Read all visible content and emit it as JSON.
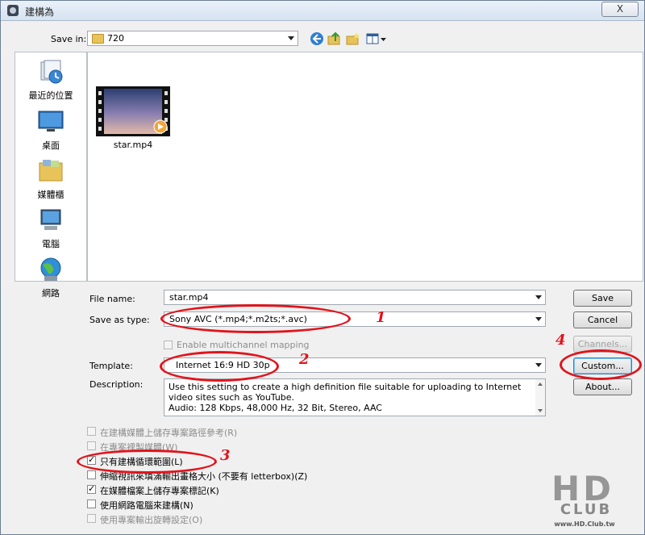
{
  "window": {
    "title": "建構為",
    "close_label": "X"
  },
  "toolbar": {
    "save_in_label": "Save in:",
    "folder": "720",
    "icons": [
      "back-icon",
      "up-folder-icon",
      "new-folder-icon",
      "views-menu-icon"
    ]
  },
  "places": [
    {
      "label": "最近的位置",
      "icon": "recent-places-icon"
    },
    {
      "label": "桌面",
      "icon": "desktop-icon"
    },
    {
      "label": "媒體櫃",
      "icon": "libraries-icon"
    },
    {
      "label": "電腦",
      "icon": "computer-icon"
    },
    {
      "label": "網路",
      "icon": "network-icon"
    }
  ],
  "files": [
    {
      "name": "star.mp4",
      "icon": "video-thumbnail"
    }
  ],
  "form": {
    "file_name_label": "File name:",
    "file_name_value": "star.mp4",
    "save_type_label": "Save as type:",
    "save_type_value": "Sony AVC (*.mp4;*.m2ts;*.avc)",
    "multichannel_label": "Enable multichannel mapping",
    "template_label": "Template:",
    "template_value": "Internet 16:9 HD 30p",
    "description_label": "Description:",
    "description_text": "Use this setting to create a high definition file suitable for uploading to Internet video sites such as YouTube.",
    "description_audio": "Audio: 128 Kbps, 48,000 Hz, 32 Bit, Stereo, AAC"
  },
  "buttons": {
    "save": "Save",
    "cancel": "Cancel",
    "channels": "Channels...",
    "custom": "Custom...",
    "about": "About..."
  },
  "options": [
    {
      "label": "在建構媒體上儲存專案路徑參考(R)",
      "checked": false,
      "enabled": false
    },
    {
      "label": "在專案裡製媒體(W)",
      "checked": false,
      "enabled": false
    },
    {
      "label": "只有建構循環範圍(L)",
      "checked": true,
      "enabled": true
    },
    {
      "label": "伸縮視訊來填滿輸出畫格大小 (不要有 letterbox)(Z)",
      "checked": false,
      "enabled": true
    },
    {
      "label": "在媒體檔案上儲存專案標記(K)",
      "checked": true,
      "enabled": true
    },
    {
      "label": "使用網路電腦來建構(N)",
      "checked": false,
      "enabled": true
    },
    {
      "label": "使用專案輸出旋轉設定(O)",
      "checked": false,
      "enabled": false
    }
  ],
  "annotations": {
    "n1": "1",
    "n2": "2",
    "n3": "3",
    "n4": "4",
    "color": "#e1141c"
  },
  "watermark": {
    "logo": "HD",
    "club": "CLUB",
    "url": "www.HD.Club.tw"
  },
  "check_mark": "✓"
}
